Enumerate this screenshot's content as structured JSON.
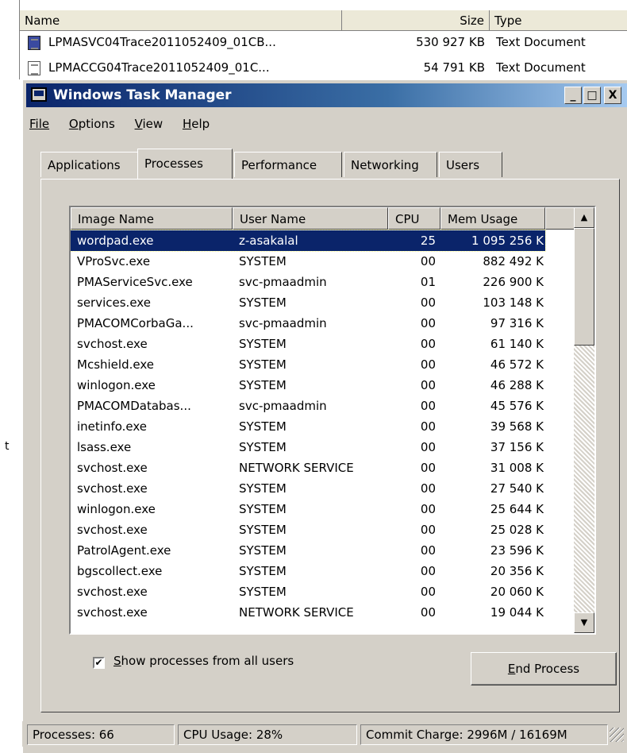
{
  "explorer": {
    "columns": {
      "name": "Name",
      "size": "Size",
      "type": "Type"
    },
    "files": [
      {
        "name": "LPMASVC04Trace2011052409_01CB...",
        "size": "530 927 KB",
        "type": "Text Document"
      },
      {
        "name": "LPMACCG04Trace2011052409_01C...",
        "size": "54 791 KB",
        "type": "Text Document"
      }
    ],
    "left_fragment": "t"
  },
  "window": {
    "title": "Windows Task Manager",
    "controls": {
      "minimize": "_",
      "maximize": "□",
      "close": "X"
    }
  },
  "menu": {
    "file": "File",
    "options": "Options",
    "view": "View",
    "help": "Help"
  },
  "tabs": {
    "applications": "Applications",
    "processes": "Processes",
    "performance": "Performance",
    "networking": "Networking",
    "users": "Users"
  },
  "process_list": {
    "columns": {
      "image": "Image Name",
      "user": "User Name",
      "cpu": "CPU",
      "mem": "Mem Usage"
    },
    "rows": [
      {
        "image": "wordpad.exe",
        "user": "z-asakalal",
        "cpu": "25",
        "mem": "1 095 256 K",
        "selected": true
      },
      {
        "image": "VProSvc.exe",
        "user": "SYSTEM",
        "cpu": "00",
        "mem": "882 492 K"
      },
      {
        "image": "PMAServiceSvc.exe",
        "user": "svc-pmaadmin",
        "cpu": "01",
        "mem": "226 900 K"
      },
      {
        "image": "services.exe",
        "user": "SYSTEM",
        "cpu": "00",
        "mem": "103 148 K"
      },
      {
        "image": "PMACOMCorbaGa...",
        "user": "svc-pmaadmin",
        "cpu": "00",
        "mem": "97 316 K"
      },
      {
        "image": "svchost.exe",
        "user": "SYSTEM",
        "cpu": "00",
        "mem": "61 140 K"
      },
      {
        "image": "Mcshield.exe",
        "user": "SYSTEM",
        "cpu": "00",
        "mem": "46 572 K"
      },
      {
        "image": "winlogon.exe",
        "user": "SYSTEM",
        "cpu": "00",
        "mem": "46 288 K"
      },
      {
        "image": "PMACOMDatabas...",
        "user": "svc-pmaadmin",
        "cpu": "00",
        "mem": "45 576 K"
      },
      {
        "image": "inetinfo.exe",
        "user": "SYSTEM",
        "cpu": "00",
        "mem": "39 568 K"
      },
      {
        "image": "lsass.exe",
        "user": "SYSTEM",
        "cpu": "00",
        "mem": "37 156 K"
      },
      {
        "image": "svchost.exe",
        "user": "NETWORK SERVICE",
        "cpu": "00",
        "mem": "31 008 K"
      },
      {
        "image": "svchost.exe",
        "user": "SYSTEM",
        "cpu": "00",
        "mem": "27 540 K"
      },
      {
        "image": "winlogon.exe",
        "user": "SYSTEM",
        "cpu": "00",
        "mem": "25 644 K"
      },
      {
        "image": "svchost.exe",
        "user": "SYSTEM",
        "cpu": "00",
        "mem": "25 028 K"
      },
      {
        "image": "PatrolAgent.exe",
        "user": "SYSTEM",
        "cpu": "00",
        "mem": "23 596 K"
      },
      {
        "image": "bgscollect.exe",
        "user": "SYSTEM",
        "cpu": "00",
        "mem": "20 356 K"
      },
      {
        "image": "svchost.exe",
        "user": "SYSTEM",
        "cpu": "00",
        "mem": "20 060 K"
      },
      {
        "image": "svchost.exe",
        "user": "NETWORK SERVICE",
        "cpu": "00",
        "mem": "19 044 K"
      }
    ]
  },
  "show_all": {
    "checked": true,
    "label": "Show processes from all users"
  },
  "end_process": "End Process",
  "status": {
    "processes": "Processes: 66",
    "cpu": "CPU Usage: 28%",
    "commit": "Commit Charge: 2996M / 16169M"
  },
  "colors": {
    "title_active": "#0a246a",
    "selection": "#0a246a",
    "face": "#d4d0c8"
  }
}
